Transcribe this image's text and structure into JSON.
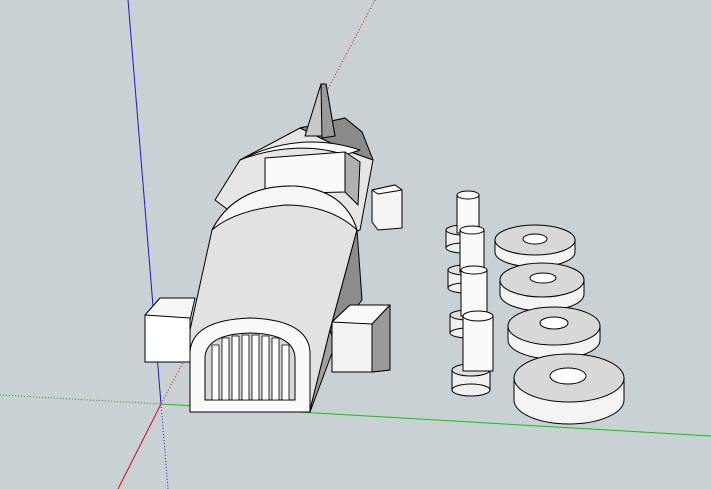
{
  "viewport": {
    "background": "#c9d1d5",
    "axis_colors": {
      "red": "#d01010",
      "green": "#10c010",
      "blue": "#1010d0"
    },
    "model": {
      "parts": [
        "fuselage",
        "nose-cone",
        "cockpit",
        "wing-left",
        "wing-right",
        "wing-rear",
        "pegs",
        "washers"
      ],
      "peg_count": 4,
      "washer_count": 4
    }
  }
}
